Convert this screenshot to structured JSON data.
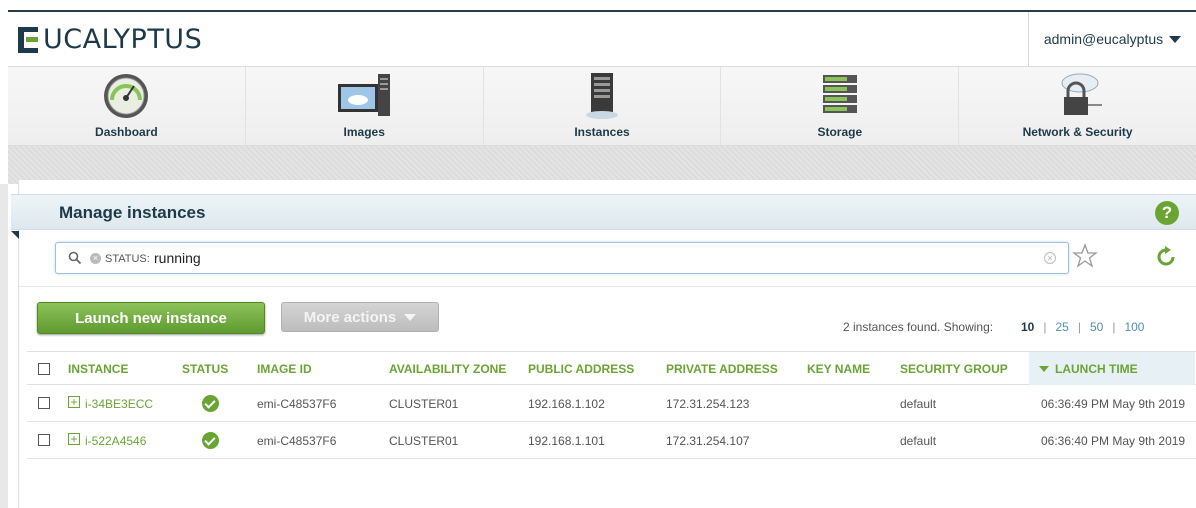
{
  "header": {
    "logo_text": "UCALYPTUS",
    "user": "admin@eucalyptus"
  },
  "nav": [
    {
      "label": "Dashboard",
      "icon": "dashboard-gauge-icon"
    },
    {
      "label": "Images",
      "icon": "images-monitor-icon"
    },
    {
      "label": "Instances",
      "icon": "instances-server-icon"
    },
    {
      "label": "Storage",
      "icon": "storage-disk-icon"
    },
    {
      "label": "Network & Security",
      "icon": "network-lock-icon"
    }
  ],
  "page": {
    "title": "Manage instances",
    "help": "?"
  },
  "search": {
    "facet_key": "STATUS:",
    "facet_value": "running"
  },
  "actions": {
    "launch": "Launch new instance",
    "more": "More actions"
  },
  "results": {
    "count_text": "2 instances found. Showing:",
    "page_sizes": [
      "10",
      "25",
      "50",
      "100"
    ],
    "sep": "|"
  },
  "table": {
    "columns": [
      "INSTANCE",
      "STATUS",
      "IMAGE ID",
      "AVAILABILITY ZONE",
      "PUBLIC ADDRESS",
      "PRIVATE ADDRESS",
      "KEY NAME",
      "SECURITY GROUP",
      "LAUNCH TIME"
    ],
    "rows": [
      {
        "instance": "i-34BE3ECC",
        "image": "emi-C48537F6",
        "zone": "CLUSTER01",
        "public": "192.168.1.102",
        "private": "172.31.254.123",
        "key": "",
        "group": "default",
        "launch": "06:36:49 PM May 9th 2019"
      },
      {
        "instance": "i-522A4546",
        "image": "emi-C48537F6",
        "zone": "CLUSTER01",
        "public": "192.168.1.101",
        "private": "172.31.254.107",
        "key": "",
        "group": "default",
        "launch": "06:36:40 PM May 9th 2019"
      }
    ]
  },
  "colors": {
    "brand_dark": "#1d3a4a",
    "accent_green": "#6aa534",
    "link_blue": "#4f8fb8"
  }
}
